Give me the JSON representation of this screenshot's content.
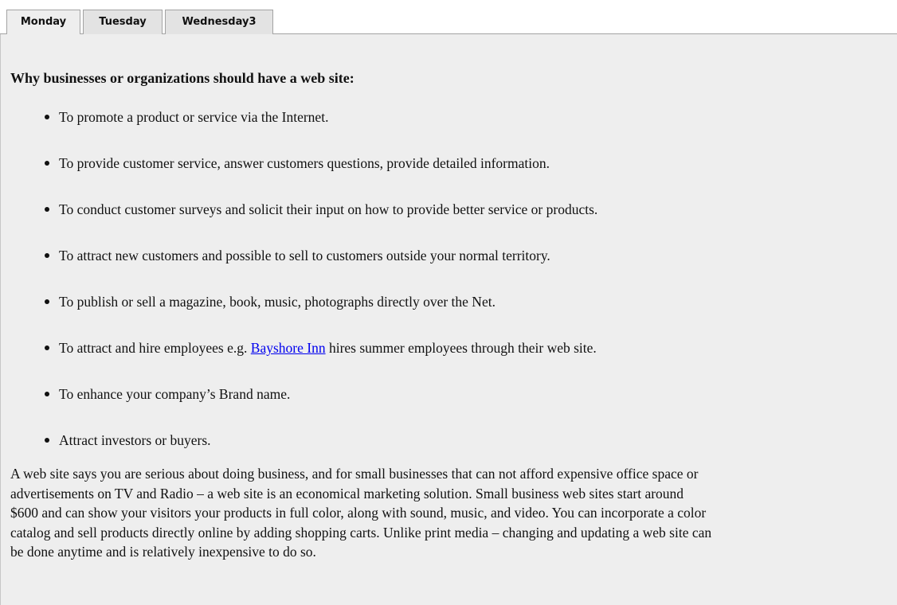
{
  "tabs": [
    {
      "label": "Monday",
      "active": true
    },
    {
      "label": "Tuesday",
      "active": false
    },
    {
      "label": "Wednesday3",
      "active": false
    }
  ],
  "content": {
    "heading": "Why businesses or organizations should have a web site:",
    "bullets": [
      {
        "text": "To promote a product or service via the Internet."
      },
      {
        "text": "To provide customer service, answer customers questions, provide detailed information."
      },
      {
        "text": "To conduct customer surveys and solicit their input on how to provide better service or products."
      },
      {
        "text": "To attract new customers and possible to sell to customers outside your normal territory."
      },
      {
        "text": "To publish or sell a magazine, book, music, photographs directly over the Net."
      },
      {
        "before": "To attract and hire employees e.g. ",
        "link": "Bayshore Inn",
        "after": " hires summer employees through their web site."
      },
      {
        "text": "To enhance your company’s Brand name."
      },
      {
        "text": "Attract investors or buyers."
      }
    ],
    "paragraph_lines": [
      "A web site says you are serious about doing business, and for small businesses that can not afford expensive office space or",
      "advertisements on TV and Radio – a web site is an economical marketing solution. Small business web sites start around",
      "$600 and can show your visitors your products in full color, along with sound, music, and video. You can incorporate a color",
      "catalog and sell products directly online by adding shopping carts. Unlike print media – changing and updating a web site can",
      "be done anytime and is relatively inexpensive to do so."
    ]
  },
  "colors": {
    "panel_background": "#eeeeee",
    "tab_background": "#e3e3e3",
    "link": "#0000ee",
    "border": "#a3a3a3"
  }
}
